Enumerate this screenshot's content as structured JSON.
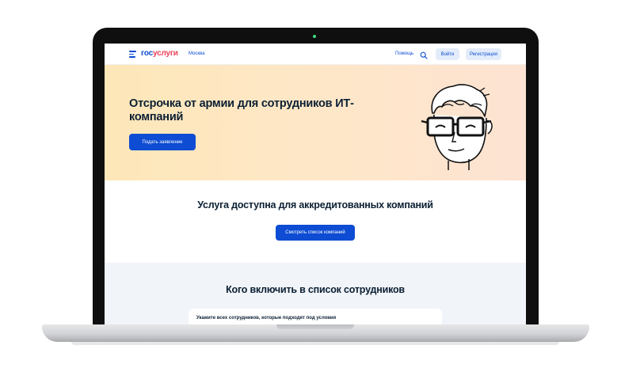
{
  "header": {
    "logo_gos": "гос",
    "logo_uslugi": "услуги",
    "city": "Москва",
    "help_label": "Помощь",
    "login_label": "Войти",
    "register_label": "Регистрация"
  },
  "hero": {
    "title": "Отсрочка от армии для сотрудников ИТ-компаний",
    "button_label": "Подать заявление"
  },
  "availability": {
    "title": "Услуга доступна для аккредитованных компаний",
    "button_label": "Смотреть список компаний"
  },
  "who": {
    "title": "Кого включить в список сотрудников",
    "card_text": "Укажите всех сотрудников, которые подходят под условия"
  },
  "colors": {
    "brand_blue": "#0d4cd3",
    "brand_red": "#ee3f58",
    "hero_bg_left": "#fde7b8",
    "hero_bg_right": "#fde3d3",
    "section_bg": "#f1f4f9"
  },
  "icons": {
    "menu": "menu-icon",
    "search": "search-icon",
    "camera": "camera-dot",
    "illustration": "man-with-glasses-illustration"
  }
}
